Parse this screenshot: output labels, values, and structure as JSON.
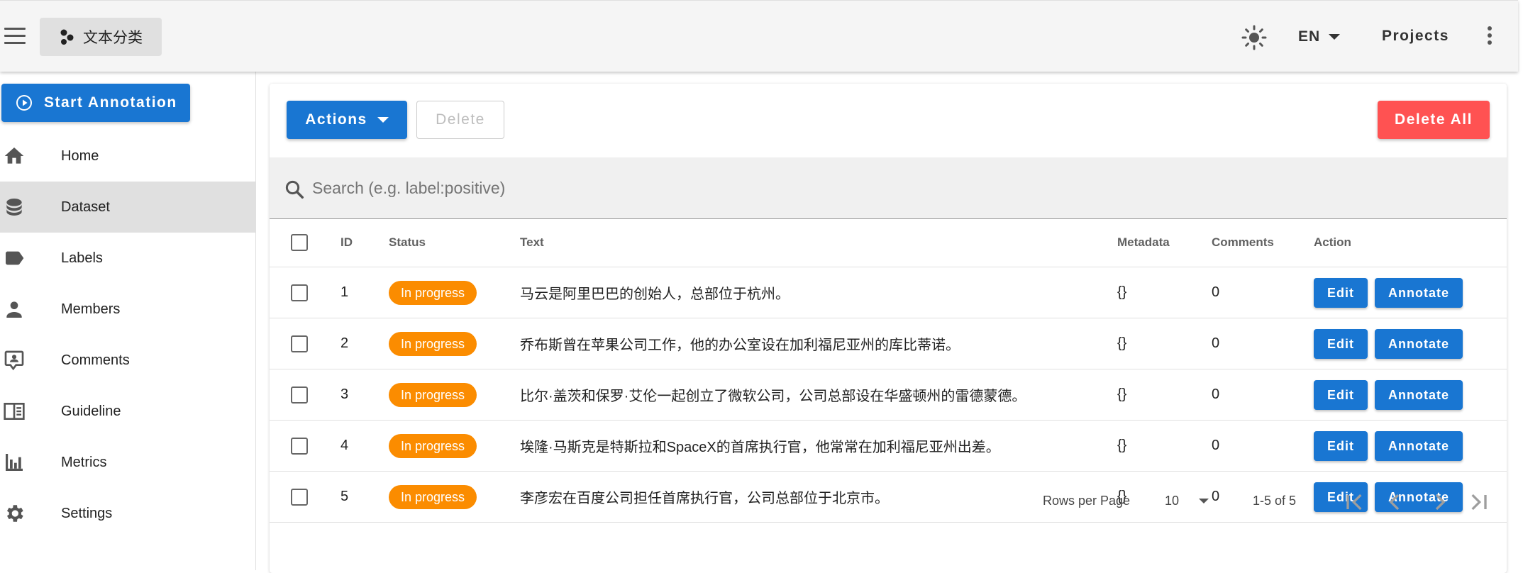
{
  "appbar": {
    "project_name": "文本分类",
    "language": "EN",
    "projects_label": "Projects"
  },
  "sidebar": {
    "start_annotation": "Start Annotation",
    "items": [
      {
        "label": "Home",
        "icon": "home-icon"
      },
      {
        "label": "Dataset",
        "icon": "database-icon",
        "active": true
      },
      {
        "label": "Labels",
        "icon": "label-icon"
      },
      {
        "label": "Members",
        "icon": "person-icon"
      },
      {
        "label": "Comments",
        "icon": "comment-account-icon"
      },
      {
        "label": "Guideline",
        "icon": "book-open-icon"
      },
      {
        "label": "Metrics",
        "icon": "bar-chart-icon"
      },
      {
        "label": "Settings",
        "icon": "gear-icon"
      }
    ]
  },
  "toolbar": {
    "actions_label": "Actions",
    "delete_label": "Delete",
    "delete_all_label": "Delete All"
  },
  "search": {
    "placeholder": "Search (e.g. label:positive)",
    "value": ""
  },
  "table": {
    "headers": {
      "id": "ID",
      "status": "Status",
      "text": "Text",
      "metadata": "Metadata",
      "comments": "Comments",
      "action": "Action"
    },
    "rows": [
      {
        "id": "1",
        "status": "In progress",
        "text": "马云是阿里巴巴的创始人，总部位于杭州。",
        "metadata": "{}",
        "comments": "0",
        "edit": "Edit",
        "annotate": "Annotate"
      },
      {
        "id": "2",
        "status": "In progress",
        "text": "乔布斯曾在苹果公司工作，他的办公室设在加利福尼亚州的库比蒂诺。",
        "metadata": "{}",
        "comments": "0",
        "edit": "Edit",
        "annotate": "Annotate"
      },
      {
        "id": "3",
        "status": "In progress",
        "text": "比尔·盖茨和保罗·艾伦一起创立了微软公司，公司总部设在华盛顿州的雷德蒙德。",
        "metadata": "{}",
        "comments": "0",
        "edit": "Edit",
        "annotate": "Annotate"
      },
      {
        "id": "4",
        "status": "In progress",
        "text": "埃隆·马斯克是特斯拉和SpaceX的首席执行官，他常常在加利福尼亚州出差。",
        "metadata": "{}",
        "comments": "0",
        "edit": "Edit",
        "annotate": "Annotate"
      },
      {
        "id": "5",
        "status": "In progress",
        "text": "李彦宏在百度公司担任首席执行官，公司总部位于北京市。",
        "metadata": "{}",
        "comments": "0",
        "edit": "Edit",
        "annotate": "Annotate"
      }
    ]
  },
  "pagination": {
    "rows_per_page_label": "Rows per Page",
    "rows_per_page_value": "10",
    "range": "1-5 of 5"
  },
  "colors": {
    "primary": "#1976d2",
    "status_chip": "#fb8c00",
    "danger": "#ff5252"
  }
}
